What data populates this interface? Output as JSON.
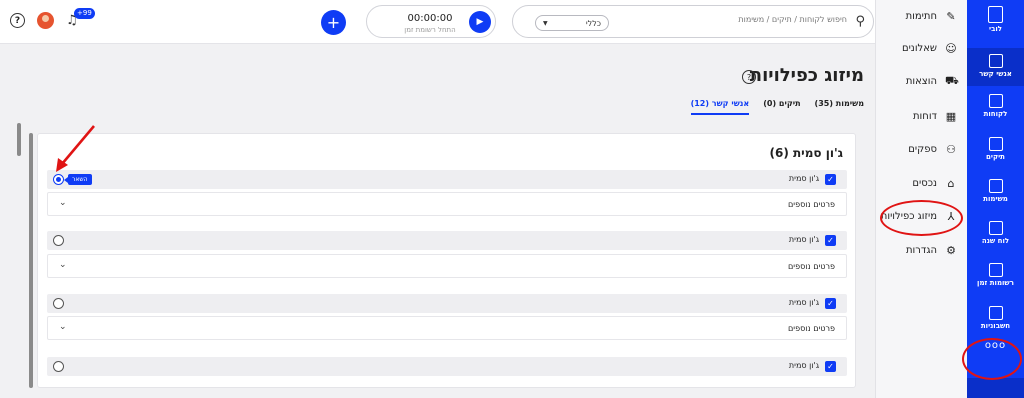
{
  "rail": {
    "items": [
      {
        "label": "לובי",
        "icon": "lobby-icon"
      },
      {
        "label": "אנשי קשר",
        "icon": "contacts-card-icon"
      },
      {
        "label": "לקוחות",
        "icon": "clients-icon"
      },
      {
        "label": "תיקים",
        "icon": "folder-icon"
      },
      {
        "label": "משימות",
        "icon": "tasks-icon"
      },
      {
        "label": "לוח שנה",
        "icon": "calendar-icon"
      },
      {
        "label": "רשומות זמן",
        "icon": "time-records-icon"
      },
      {
        "label": "חשבוניות",
        "icon": "invoice-icon"
      }
    ],
    "more": "ooo"
  },
  "sidebar": {
    "items": [
      {
        "label": "חתימות",
        "icon": "signature-icon"
      },
      {
        "label": "שאלונים",
        "icon": "questionnaire-icon"
      },
      {
        "label": "הוצאות",
        "icon": "cart-icon"
      },
      {
        "label": "דוחות",
        "icon": "reports-icon"
      },
      {
        "label": "ספקים",
        "icon": "suppliers-icon"
      },
      {
        "label": "נכסים",
        "icon": "assets-icon"
      },
      {
        "label": "מיזוג כפילויות",
        "icon": "merge-icon"
      },
      {
        "label": "הגדרות",
        "icon": "settings-icon"
      }
    ]
  },
  "topbar": {
    "search_placeholder": "חיפוש לקוחות / תיקים / משימות",
    "scope": "כללי",
    "timer_value": "00:00:00",
    "timer_label": "התחל רשומת זמן",
    "notifications": "+99"
  },
  "page": {
    "title": "מיזוג כפילויות",
    "tabs": [
      {
        "label": "משימות (35)"
      },
      {
        "label": "תיקים (0)"
      },
      {
        "label": "אנשי קשר (12)"
      }
    ]
  },
  "group": {
    "title": "ג'ון סמית (6)",
    "keep_label": "השאר",
    "more_label": "פרטים נוספים",
    "records": [
      {
        "name": "ג'ון סמית"
      },
      {
        "name": "ג'ון סמית"
      },
      {
        "name": "ג'ון סמית"
      },
      {
        "name": "ג'ון סמית"
      }
    ]
  },
  "colors": {
    "accent": "#0f3cf5",
    "annotation": "#e01414"
  }
}
